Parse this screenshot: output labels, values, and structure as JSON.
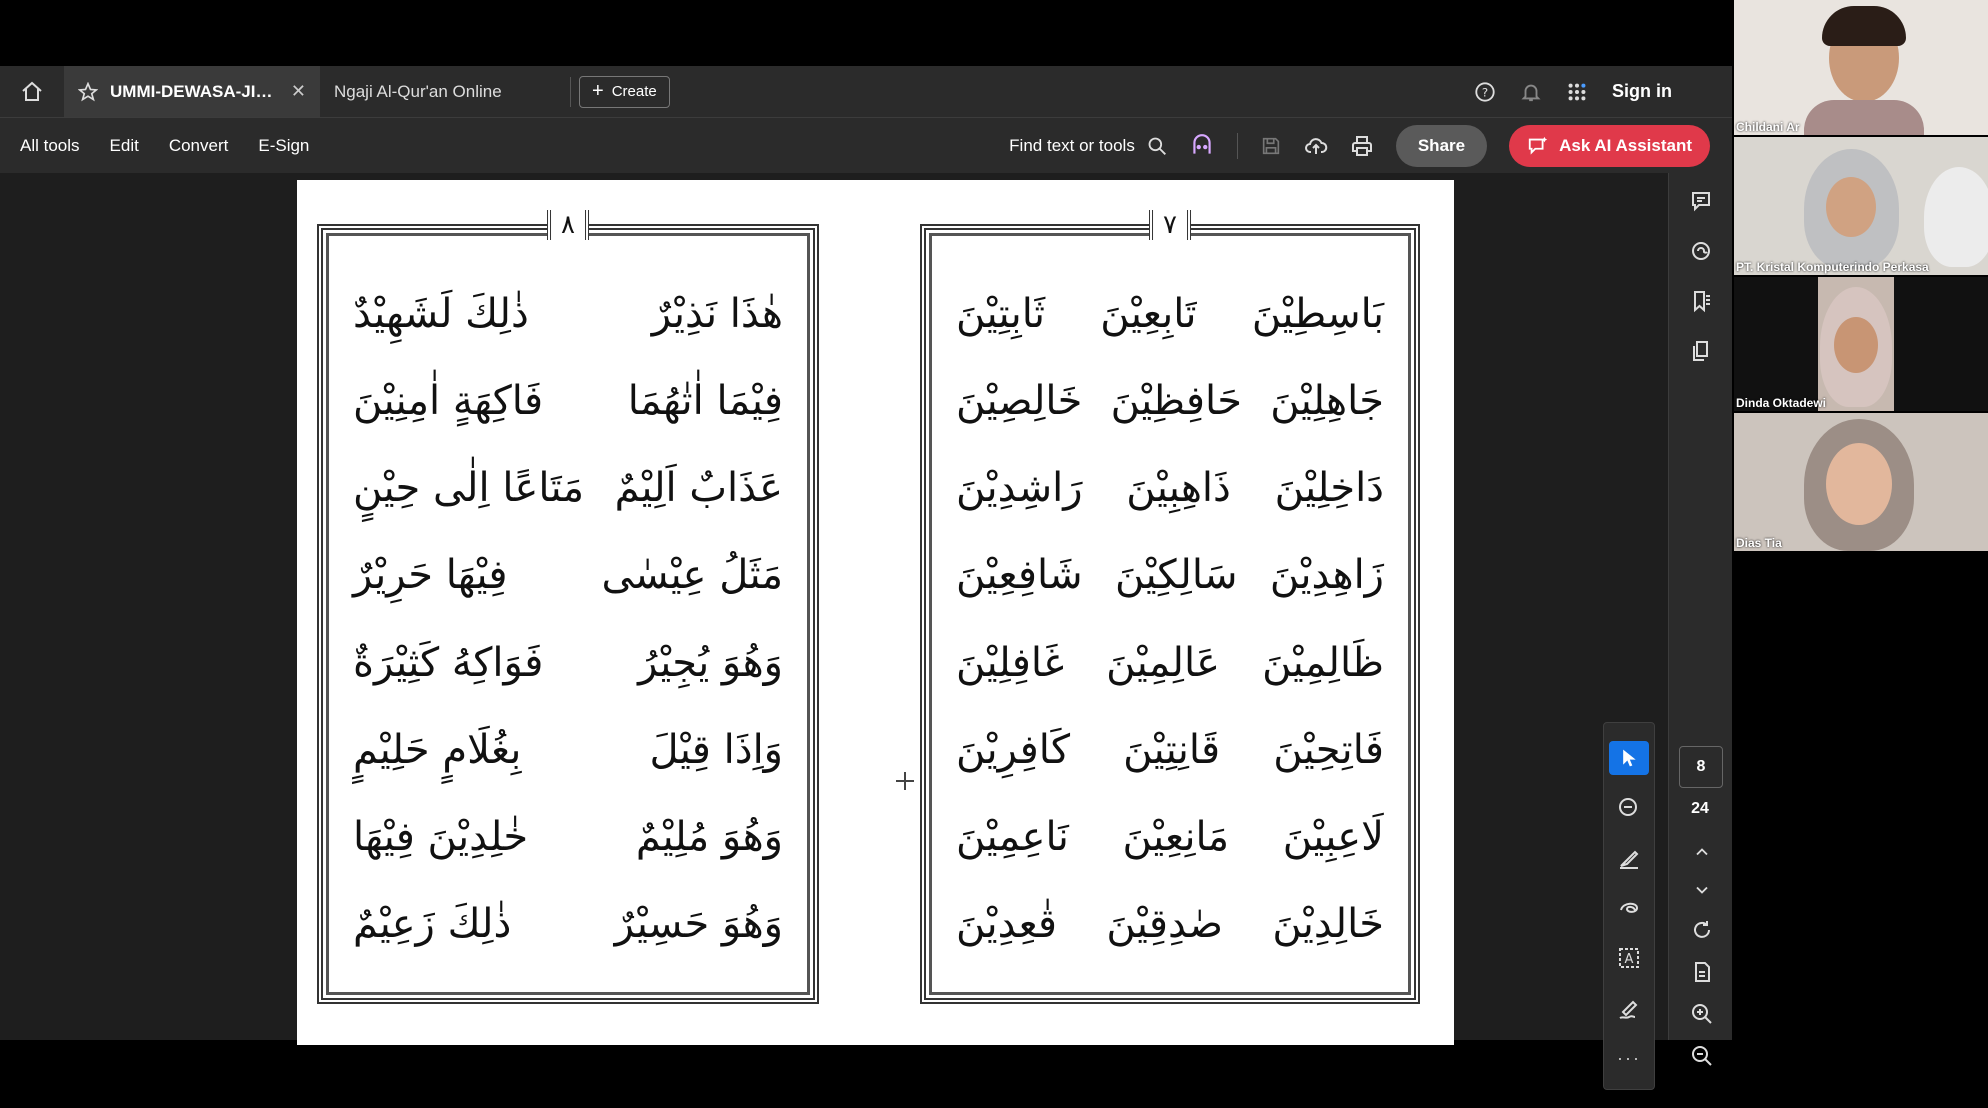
{
  "tabs": {
    "active_title": "UMMI-DEWASA-JILID-...",
    "inactive_title": "Ngaji Al-Qur'an Online",
    "create_label": "Create",
    "sign_in": "Sign in"
  },
  "toolbar": {
    "menu": [
      "All tools",
      "Edit",
      "Convert",
      "E-Sign"
    ],
    "find_label": "Find text or tools",
    "share_label": "Share",
    "ask_label": "Ask AI Assistant",
    "ask_color": "#e0394a"
  },
  "document": {
    "left_page_number": "٨",
    "right_page_number": "٧",
    "left_rows": [
      [
        "هٰذَا نَذِيْرٌ",
        "ذٰلِكَ لَشَهِيْدٌ"
      ],
      [
        "فِيْمَا اٰتٰهُمَا",
        "فَاكِهَةٍ اٰمِنِيْنَ"
      ],
      [
        "عَذَابٌ اَلِيْمٌ",
        "مَتَاعًا اِلٰى حِيْنٍ"
      ],
      [
        "مَثَلُ عِيْسٰى",
        "فِيْهَا حَرِيْرٌ"
      ],
      [
        "وَهُوَ يُجِيْرُ",
        "فَوَاكِهُ كَثِيْرَةٌ"
      ],
      [
        "وَاِذَا قِيْلَ",
        "بِغُلَامٍ حَلِيْمٍ"
      ],
      [
        "وَهُوَ مُلِيْمٌ",
        "خٰلِدِيْنَ فِيْهَا"
      ],
      [
        "وَهُوَ حَسِيْرٌ",
        "ذٰلِكَ زَعِيْمٌ"
      ]
    ],
    "right_rows": [
      [
        "بَاسِطِيْنَ",
        "تَابِعِيْنَ",
        "ثَابِتِيْنَ"
      ],
      [
        "جَاهِلِيْنَ",
        "حَافِظِيْنَ",
        "خَالِصِيْنَ"
      ],
      [
        "دَاخِلِيْنَ",
        "ذَاهِبِيْنَ",
        "رَاشِدِيْنَ"
      ],
      [
        "زَاهِدِيْنَ",
        "سَالِكِيْنَ",
        "شَافِعِيْنَ"
      ],
      [
        "ظَالِمِيْنَ",
        "عَالِمِيْنَ",
        "غَافِلِيْنَ"
      ],
      [
        "فَاتِحِيْنَ",
        "قَانِتِيْنَ",
        "كَافِرِيْنَ"
      ],
      [
        "لَاعِبِيْنَ",
        "مَانِعِيْنَ",
        "نَاعِمِيْنَ"
      ],
      [
        "خَالِدِيْنَ",
        "صٰدِقِيْنَ",
        "قٰعِدِيْنَ"
      ]
    ]
  },
  "page_nav": {
    "current": "8",
    "total": "24"
  },
  "participants": [
    "Childani Ar",
    "PT. Kristal Komputerindo Perkasa",
    "Dinda Oktadewi",
    "Dias Tia"
  ]
}
